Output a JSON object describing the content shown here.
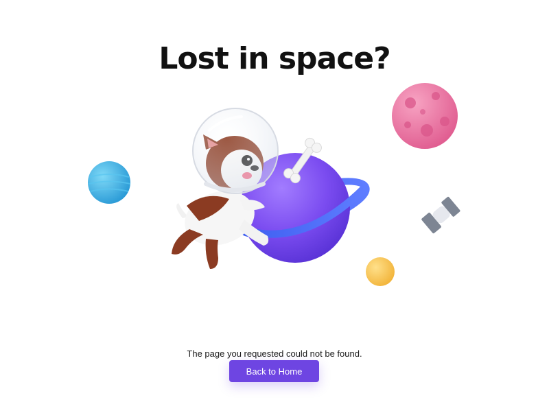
{
  "heading": "Lost in space?",
  "message": "The page you requested could not be found.",
  "button_label": "Back to Home",
  "illustration": {
    "icons": [
      "astronaut-dog-icon",
      "ringed-planet-icon",
      "bone-icon",
      "blue-planet-icon",
      "pink-moon-icon",
      "yellow-planet-icon",
      "satellite-icon"
    ]
  },
  "colors": {
    "accent": "#6e45e2",
    "ringed_planet": "#7b4cf0",
    "ring": "#4d6cf5",
    "blue_planet": "#3bb4e6",
    "pink_moon": "#ea6c9c",
    "yellow_planet": "#f6c24a",
    "dog_brown": "#8b3b22",
    "heading": "#111111"
  }
}
